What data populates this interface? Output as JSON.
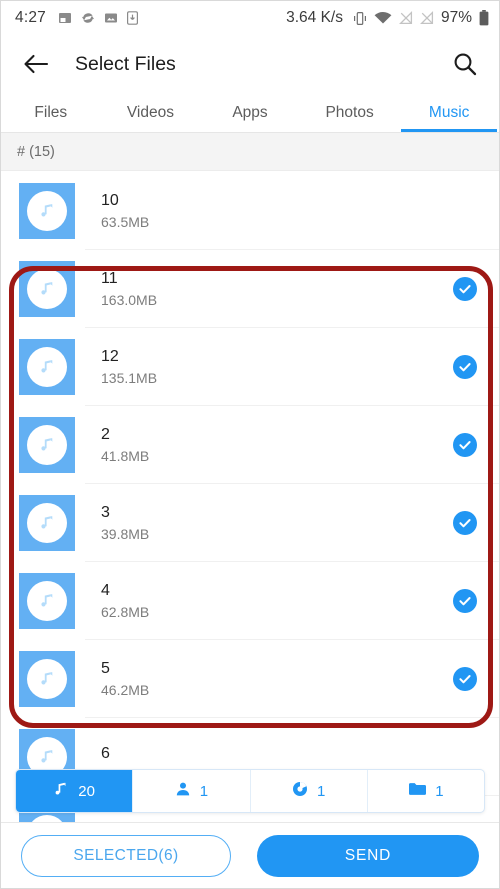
{
  "status_bar": {
    "time": "4:27",
    "network_speed": "3.64 K/s",
    "battery_percent": "97%",
    "left_icons": [
      "screenshot-icon",
      "sync-icon",
      "gallery-icon",
      "download-icon"
    ],
    "right_icons": [
      "vibrate-icon",
      "wifi-icon",
      "signal-off-icon",
      "signal-off-2-icon",
      "battery-icon"
    ]
  },
  "appbar": {
    "title": "Select Files",
    "back_icon": "arrow-left-icon",
    "search_icon": "search-icon"
  },
  "tabs": [
    {
      "label": "Files",
      "active": false
    },
    {
      "label": "Videos",
      "active": false
    },
    {
      "label": "Apps",
      "active": false
    },
    {
      "label": "Photos",
      "active": false
    },
    {
      "label": "Music",
      "active": true
    }
  ],
  "section": {
    "label": "# (15)"
  },
  "files": [
    {
      "name": "10",
      "size": "63.5MB",
      "selected": false
    },
    {
      "name": "11",
      "size": "163.0MB",
      "selected": true
    },
    {
      "name": "12",
      "size": "135.1MB",
      "selected": true
    },
    {
      "name": "2",
      "size": "41.8MB",
      "selected": true
    },
    {
      "name": "3",
      "size": "39.8MB",
      "selected": true
    },
    {
      "name": "4",
      "size": "62.8MB",
      "selected": true
    },
    {
      "name": "5",
      "size": "46.2MB",
      "selected": true
    },
    {
      "name": "6",
      "size": "",
      "selected": false
    },
    {
      "name": "",
      "size": "",
      "selected": false
    }
  ],
  "category_bar": [
    {
      "icon": "music-note-icon",
      "count": "20",
      "active": true
    },
    {
      "icon": "person-icon",
      "count": "1",
      "active": false
    },
    {
      "icon": "disc-icon",
      "count": "1",
      "active": false
    },
    {
      "icon": "folder-icon",
      "count": "1",
      "active": false
    }
  ],
  "bottom_bar": {
    "selected_label": "SELECTED(6)",
    "send_label": "SEND"
  },
  "annotation": {
    "shape": "rounded-rectangle",
    "color": "#9e1915"
  },
  "colors": {
    "accent": "#2196f3",
    "thumb": "#63b0f3",
    "annotation": "#9e1915"
  }
}
